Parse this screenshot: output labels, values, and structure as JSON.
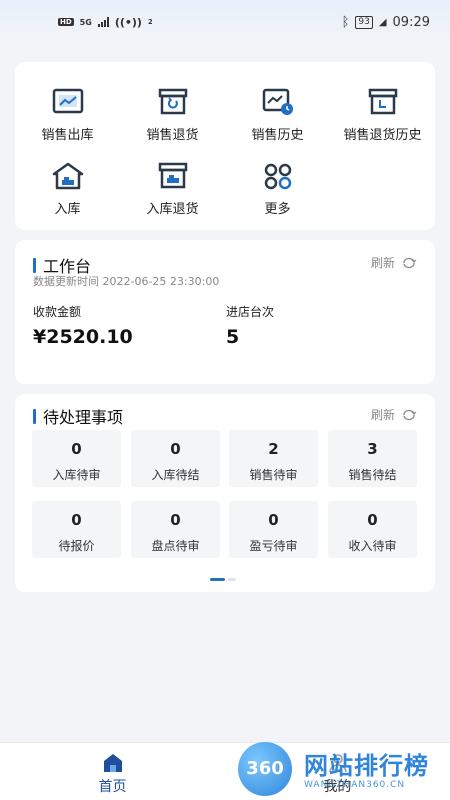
{
  "status_bar": {
    "hd": "HD",
    "network": "5G",
    "wifi_badge": "2",
    "battery": "93",
    "time": "09:29"
  },
  "quick_menu": {
    "items": [
      {
        "label": "销售出库",
        "icon": "sales-out-icon"
      },
      {
        "label": "销售退货",
        "icon": "sales-return-icon"
      },
      {
        "label": "销售历史",
        "icon": "sales-history-icon"
      },
      {
        "label": "销售退货历史",
        "icon": "sales-return-history-icon"
      },
      {
        "label": "入库",
        "icon": "inbound-icon"
      },
      {
        "label": "入库退货",
        "icon": "inbound-return-icon"
      },
      {
        "label": "更多",
        "icon": "more-icon"
      }
    ]
  },
  "workbench": {
    "title": "工作台",
    "refresh_label": "刷新",
    "update_time": "数据更新时间 2022-06-25 23:30:00",
    "stats": [
      {
        "label": "收款金额",
        "value": "¥2520.10"
      },
      {
        "label": "进店台次",
        "value": "5"
      }
    ]
  },
  "pending": {
    "title": "待处理事项",
    "refresh_label": "刷新",
    "items": [
      {
        "count": "0",
        "label": "入库待审"
      },
      {
        "count": "0",
        "label": "入库待结"
      },
      {
        "count": "2",
        "label": "销售待审"
      },
      {
        "count": "3",
        "label": "销售待结"
      },
      {
        "count": "0",
        "label": "待报价"
      },
      {
        "count": "0",
        "label": "盘点待审"
      },
      {
        "count": "0",
        "label": "盈亏待审"
      },
      {
        "count": "0",
        "label": "收入待审"
      }
    ]
  },
  "tabbar": {
    "tabs": [
      {
        "label": "首页",
        "active": true
      },
      {
        "label": "我的",
        "active": false
      }
    ]
  },
  "watermark": {
    "logo": "360",
    "title": "网站排行榜",
    "url": "WANGZHAN360.CN"
  },
  "colors": {
    "accent": "#1f6fc5",
    "icon_dark": "#2b3a4a",
    "background": "#f2f4f7"
  }
}
